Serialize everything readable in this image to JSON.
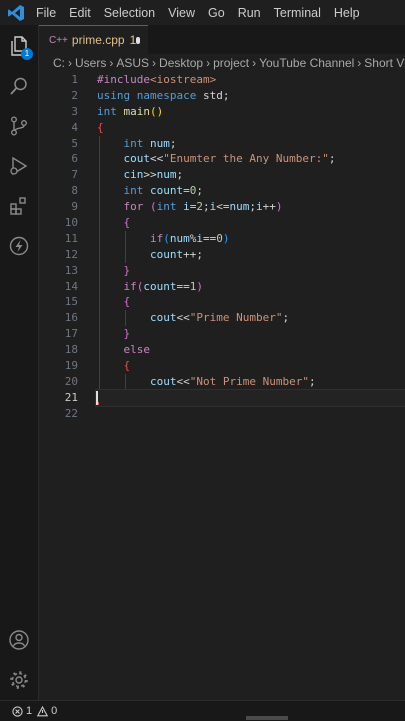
{
  "menu": [
    "File",
    "Edit",
    "Selection",
    "View",
    "Go",
    "Run",
    "Terminal",
    "Help"
  ],
  "activity": {
    "explorer_badge": "1"
  },
  "tab": {
    "icon": "C++",
    "name": "prime.cpp",
    "problems": "1"
  },
  "breadcrumb": [
    "C:",
    "Users",
    "ASUS",
    "Desktop",
    "project",
    "YouTube Channel",
    "Short Video"
  ],
  "editor": {
    "line_numbers": [
      "1",
      "2",
      "3",
      "4",
      "5",
      "6",
      "7",
      "8",
      "9",
      "10",
      "11",
      "12",
      "13",
      "14",
      "15",
      "16",
      "17",
      "18",
      "19",
      "20",
      "21",
      "22"
    ],
    "current_line": "21",
    "code": {
      "l1": {
        "directive": "#include",
        "header": "<iostream>"
      },
      "l2": {
        "using": "using",
        "namespace": "namespace",
        "std": "std",
        "semi": ";"
      },
      "l3": {
        "type": "int",
        "name": "main",
        "open": "(",
        "close": ")"
      },
      "l4": {
        "brace": "{"
      },
      "l5": {
        "type": "int",
        "var": "num",
        "semi": ";"
      },
      "l6": {
        "obj": "cout",
        "op": "<<",
        "str": "\"Enumter the Any Number:\"",
        "semi": ";"
      },
      "l7": {
        "obj": "cin",
        "op": ">>",
        "var": "num",
        "semi": ";"
      },
      "l8": {
        "type": "int",
        "var": "count",
        "eq": "=",
        "num": "0",
        "semi": ";"
      },
      "l9": {
        "kw": "for",
        "open": "(",
        "type": "int",
        "init_var": "i",
        "init_eq": "=",
        "init_num": "2",
        "s1": ";",
        "cond_var": "i",
        "cond_op": "<=",
        "cond_rhs": "num",
        "s2": ";",
        "inc_var": "i",
        "inc_op": "++",
        "close": ")"
      },
      "l10": {
        "brace": "{"
      },
      "l11": {
        "kw": "if",
        "open": "(",
        "lhs": "num",
        "mod": "%",
        "rhs": "i",
        "eqeq": "==",
        "num": "0",
        "close": ")"
      },
      "l12": {
        "var": "count",
        "op": "++",
        "semi": ";"
      },
      "l13": {
        "brace": "}"
      },
      "l14": {
        "kw": "if",
        "open": "(",
        "var": "count",
        "eqeq": "==",
        "num": "1",
        "close": ")"
      },
      "l15": {
        "brace": "{"
      },
      "l16": {
        "obj": "cout",
        "op": "<<",
        "str": "\"Prime Number\"",
        "semi": ";"
      },
      "l17": {
        "brace": "}"
      },
      "l18": {
        "kw": "else"
      },
      "l19": {
        "brace": "{"
      },
      "l20": {
        "obj": "cout",
        "op": "<<",
        "str": "\"Not Prime Number\"",
        "semi": ";"
      }
    }
  },
  "status": {
    "errors": "1",
    "warnings": "0"
  },
  "colors": {
    "accent": "#0078d4",
    "error": "#f14c4c",
    "modified": "#e2c08d"
  }
}
